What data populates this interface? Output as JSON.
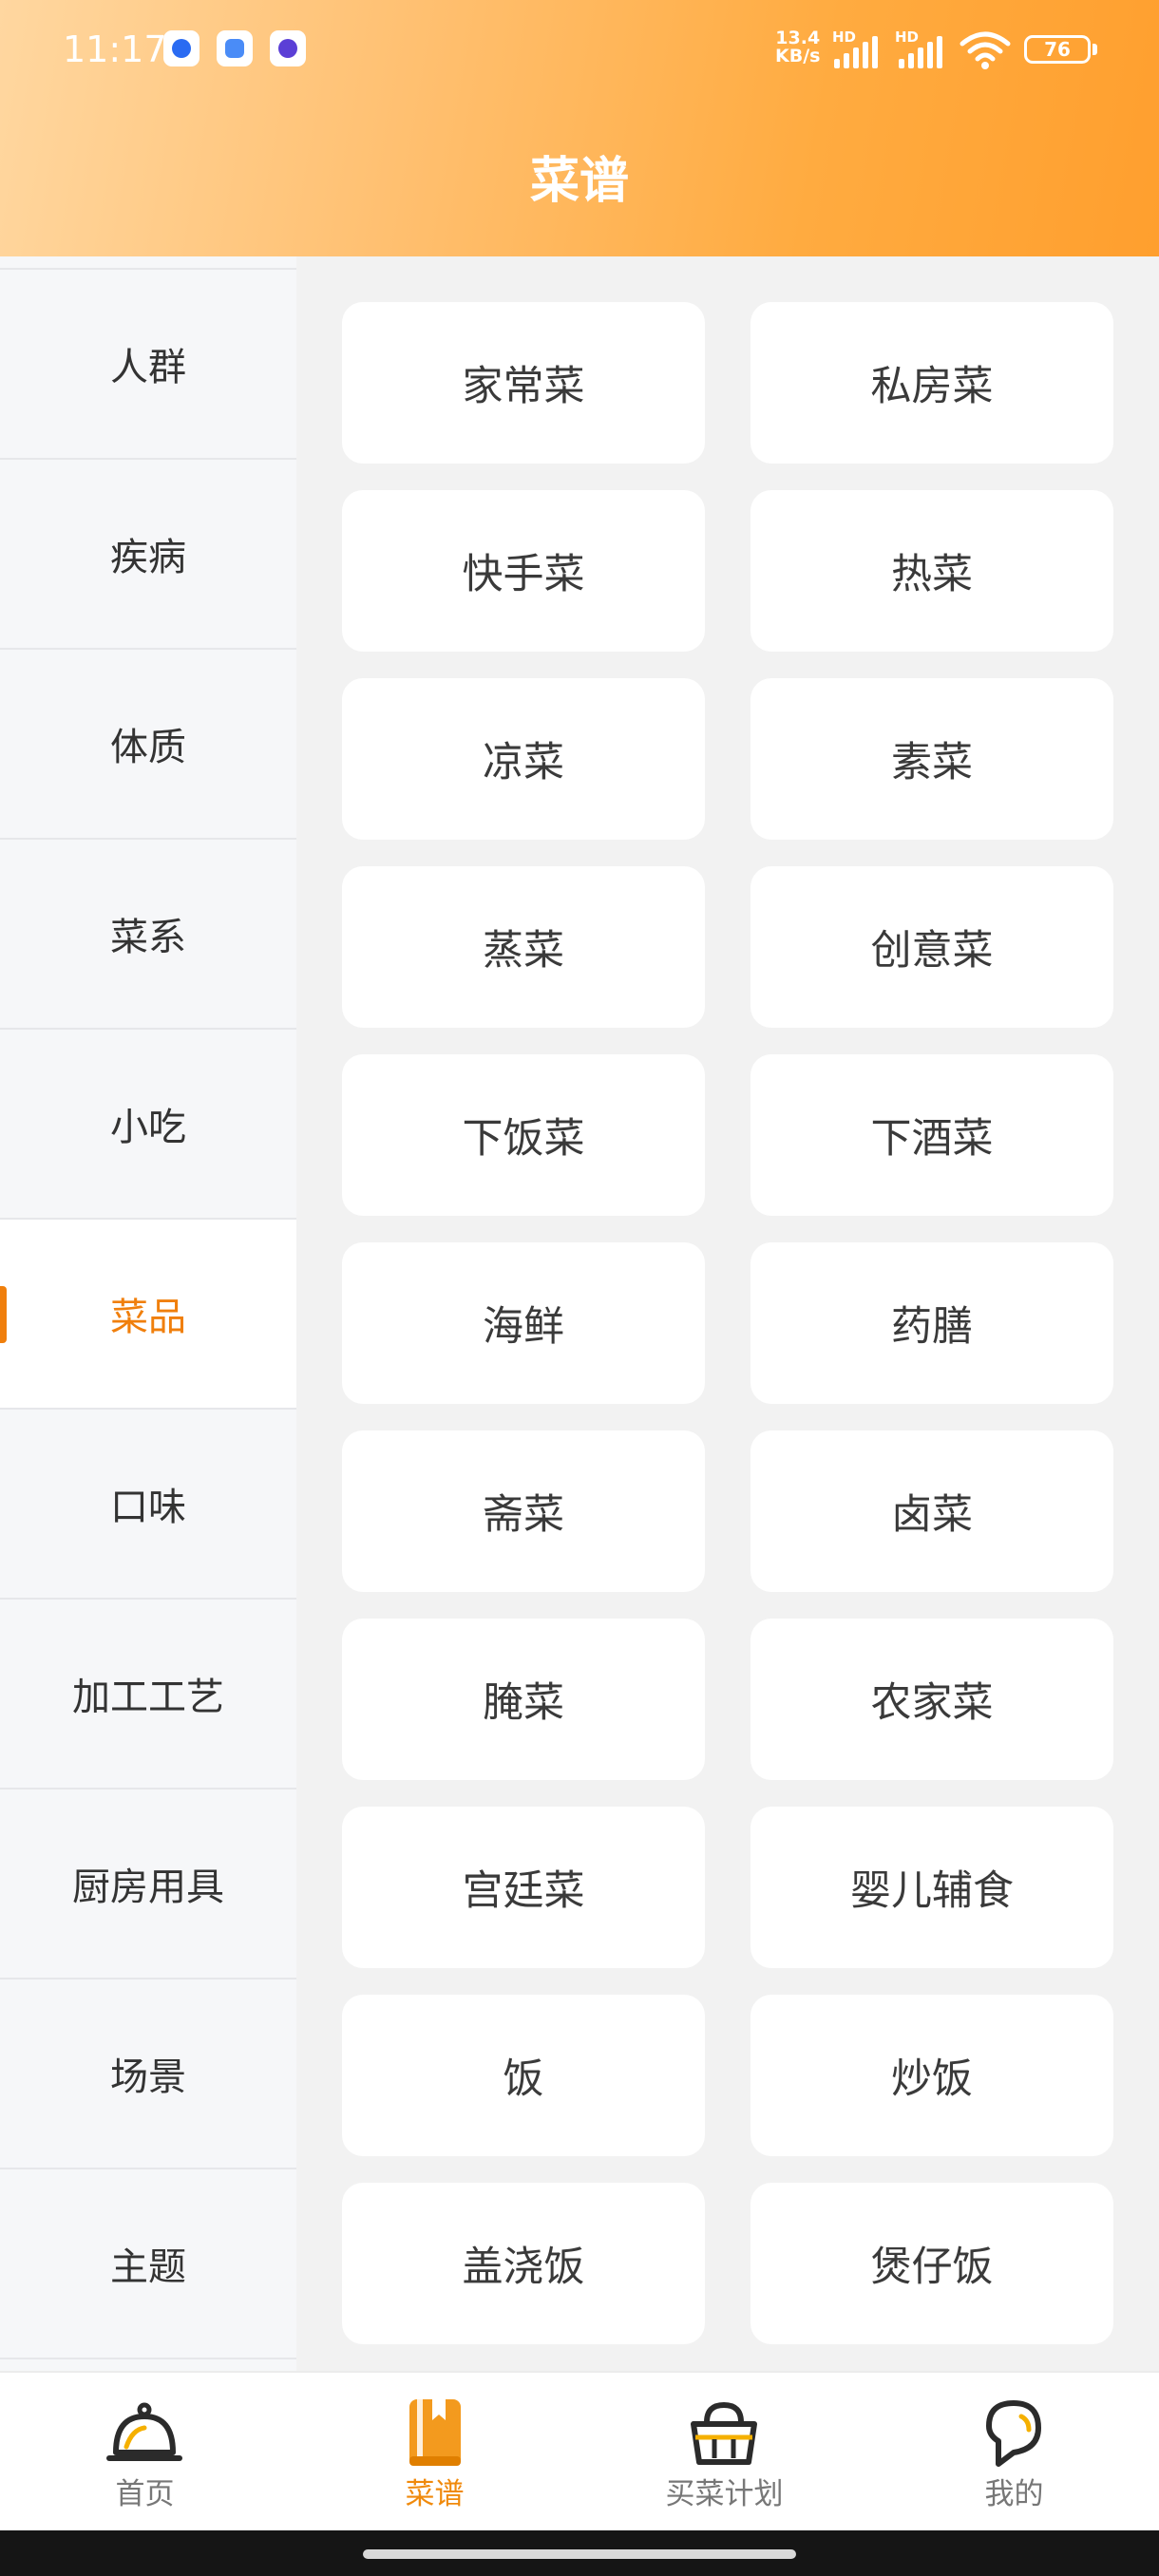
{
  "status_bar": {
    "time": "11:17",
    "net_speed_value": "13.4",
    "net_speed_unit": "KB/s",
    "hd1": "HD",
    "hd2": "HD",
    "battery": "76",
    "app_icons": [
      "app-icon-blue",
      "app-icon-cloud",
      "app-icon-purple"
    ]
  },
  "header": {
    "title": "菜谱"
  },
  "sidebar": {
    "items": [
      {
        "label": "人群"
      },
      {
        "label": "疾病"
      },
      {
        "label": "体质"
      },
      {
        "label": "菜系"
      },
      {
        "label": "小吃"
      },
      {
        "label": "菜品",
        "active": true
      },
      {
        "label": "口味"
      },
      {
        "label": "加工工艺"
      },
      {
        "label": "厨房用具"
      },
      {
        "label": "场景"
      },
      {
        "label": "主题"
      }
    ]
  },
  "categories": {
    "items": [
      {
        "label": "家常菜"
      },
      {
        "label": "私房菜"
      },
      {
        "label": "快手菜"
      },
      {
        "label": "热菜"
      },
      {
        "label": "凉菜"
      },
      {
        "label": "素菜"
      },
      {
        "label": "蒸菜"
      },
      {
        "label": "创意菜"
      },
      {
        "label": "下饭菜"
      },
      {
        "label": "下酒菜"
      },
      {
        "label": "海鲜"
      },
      {
        "label": "药膳"
      },
      {
        "label": "斋菜"
      },
      {
        "label": "卤菜"
      },
      {
        "label": "腌菜"
      },
      {
        "label": "农家菜"
      },
      {
        "label": "宫廷菜"
      },
      {
        "label": "婴儿辅食"
      },
      {
        "label": "饭"
      },
      {
        "label": "炒饭"
      },
      {
        "label": "盖浇饭"
      },
      {
        "label": "煲仔饭"
      }
    ]
  },
  "tab_bar": {
    "items": [
      {
        "label": "首页",
        "icon": "cloche-icon"
      },
      {
        "label": "菜谱",
        "icon": "recipe-book-icon",
        "active": true
      },
      {
        "label": "买菜计划",
        "icon": "basket-icon"
      },
      {
        "label": "我的",
        "icon": "profile-icon"
      }
    ]
  },
  "colors": {
    "accent": "#f07f0c",
    "header_gradient_start": "#ffd7a0",
    "header_gradient_end": "#ff9f2e",
    "sidebar_bg": "#f6f7f9",
    "content_bg": "#f2f2f2"
  }
}
